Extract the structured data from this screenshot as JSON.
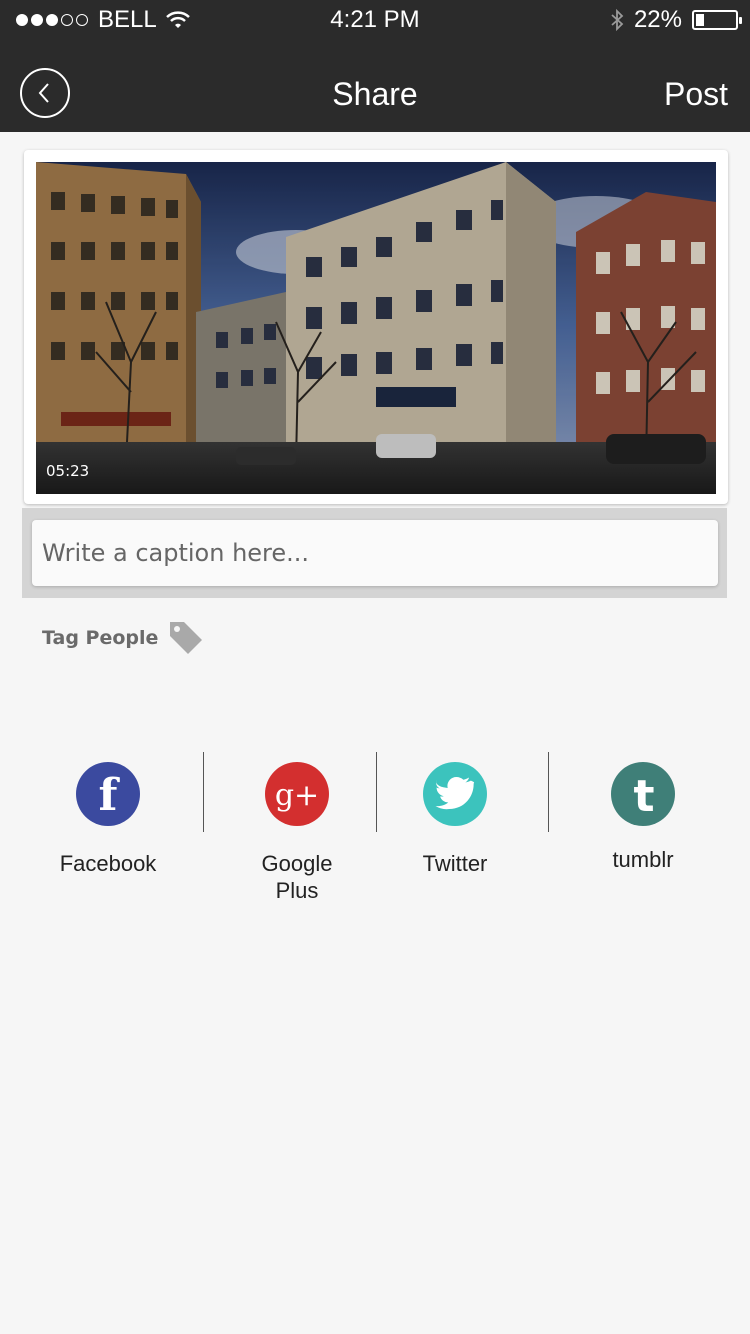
{
  "status_bar": {
    "carrier": "BELL",
    "signal_bars_filled": 3,
    "signal_bars_total": 5,
    "time": "4:21 PM",
    "battery_percent": "22%",
    "battery_level": 0.22
  },
  "nav": {
    "title": "Share",
    "post_label": "Post"
  },
  "media": {
    "duration": "05:23"
  },
  "caption": {
    "placeholder": "Write a caption here..."
  },
  "tag": {
    "label": "Tag People"
  },
  "share": [
    {
      "label": "Facebook",
      "color": "#3b4a9f",
      "icon": "facebook-icon"
    },
    {
      "label": "Google\nPlus",
      "color": "#d32f2f",
      "icon": "google-plus-icon"
    },
    {
      "label": "Twitter",
      "color": "#3cc3bd",
      "icon": "twitter-icon"
    },
    {
      "label": "tumblr",
      "color": "#3f7f78",
      "icon": "tumblr-icon"
    }
  ]
}
